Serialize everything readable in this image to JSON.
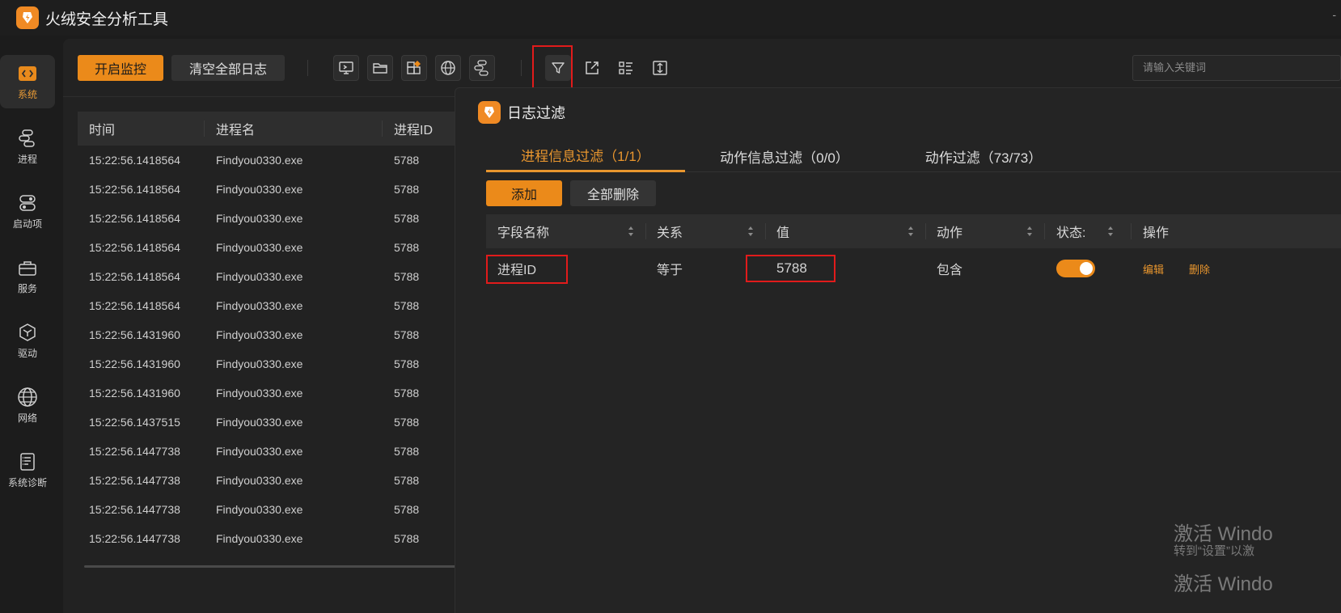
{
  "titlebar": {
    "title": "火绒安全分析工具",
    "control": "-"
  },
  "sidebar": {
    "items": [
      {
        "label": "系统",
        "icon": "code-icon",
        "active": true
      },
      {
        "label": "进程",
        "icon": "process-icon",
        "active": false
      },
      {
        "label": "启动项",
        "icon": "toggle-icon",
        "active": false
      },
      {
        "label": "服务",
        "icon": "service-icon",
        "active": false
      },
      {
        "label": "驱动",
        "icon": "cube-icon",
        "active": false
      },
      {
        "label": "网络",
        "icon": "globe-icon",
        "active": false
      },
      {
        "label": "系统诊断",
        "icon": "diagnose-icon",
        "active": false
      }
    ]
  },
  "toolbar": {
    "start_monitor": "开启监控",
    "clear_logs": "清空全部日志",
    "search_placeholder": "请输入关键词",
    "icons": [
      "monitor-icon",
      "folder-icon",
      "registry-icon",
      "network-icon",
      "process-tree-icon",
      "filter-icon",
      "export-icon",
      "column-list-icon",
      "fit-height-icon"
    ]
  },
  "log_table": {
    "columns": [
      "时间",
      "进程名",
      "进程ID"
    ],
    "rows": [
      {
        "time": "15:22:56.1418564",
        "name": "Findyou0330.exe",
        "pid": "5788"
      },
      {
        "time": "15:22:56.1418564",
        "name": "Findyou0330.exe",
        "pid": "5788"
      },
      {
        "time": "15:22:56.1418564",
        "name": "Findyou0330.exe",
        "pid": "5788"
      },
      {
        "time": "15:22:56.1418564",
        "name": "Findyou0330.exe",
        "pid": "5788"
      },
      {
        "time": "15:22:56.1418564",
        "name": "Findyou0330.exe",
        "pid": "5788"
      },
      {
        "time": "15:22:56.1418564",
        "name": "Findyou0330.exe",
        "pid": "5788"
      },
      {
        "time": "15:22:56.1431960",
        "name": "Findyou0330.exe",
        "pid": "5788"
      },
      {
        "time": "15:22:56.1431960",
        "name": "Findyou0330.exe",
        "pid": "5788"
      },
      {
        "time": "15:22:56.1431960",
        "name": "Findyou0330.exe",
        "pid": "5788"
      },
      {
        "time": "15:22:56.1437515",
        "name": "Findyou0330.exe",
        "pid": "5788"
      },
      {
        "time": "15:22:56.1447738",
        "name": "Findyou0330.exe",
        "pid": "5788"
      },
      {
        "time": "15:22:56.1447738",
        "name": "Findyou0330.exe",
        "pid": "5788"
      },
      {
        "time": "15:22:56.1447738",
        "name": "Findyou0330.exe",
        "pid": "5788"
      },
      {
        "time": "15:22:56.1447738",
        "name": "Findyou0330.exe",
        "pid": "5788"
      }
    ]
  },
  "filter_dialog": {
    "title": "日志过滤",
    "tabs": [
      {
        "label": "进程信息过滤（1/1）",
        "active": true
      },
      {
        "label": "动作信息过滤（0/0）",
        "active": false
      },
      {
        "label": "动作过滤（73/73）",
        "active": false
      }
    ],
    "add_button": "添加",
    "delete_all_button": "全部删除",
    "columns": [
      "字段名称",
      "关系",
      "值",
      "动作",
      "状态:",
      "操作"
    ],
    "rows": [
      {
        "field": "进程ID",
        "relation": "等于",
        "value": "5788",
        "action": "包含",
        "enabled": true,
        "edit": "编辑",
        "delete": "删除"
      }
    ]
  },
  "watermark": {
    "line1": "激活 Windo",
    "line2": "转到“设置”以激",
    "line3": "激活 Windo"
  },
  "colors": {
    "accent": "#eb8a1a",
    "highlight": "#e11b1b",
    "background": "#1c1c1c"
  }
}
